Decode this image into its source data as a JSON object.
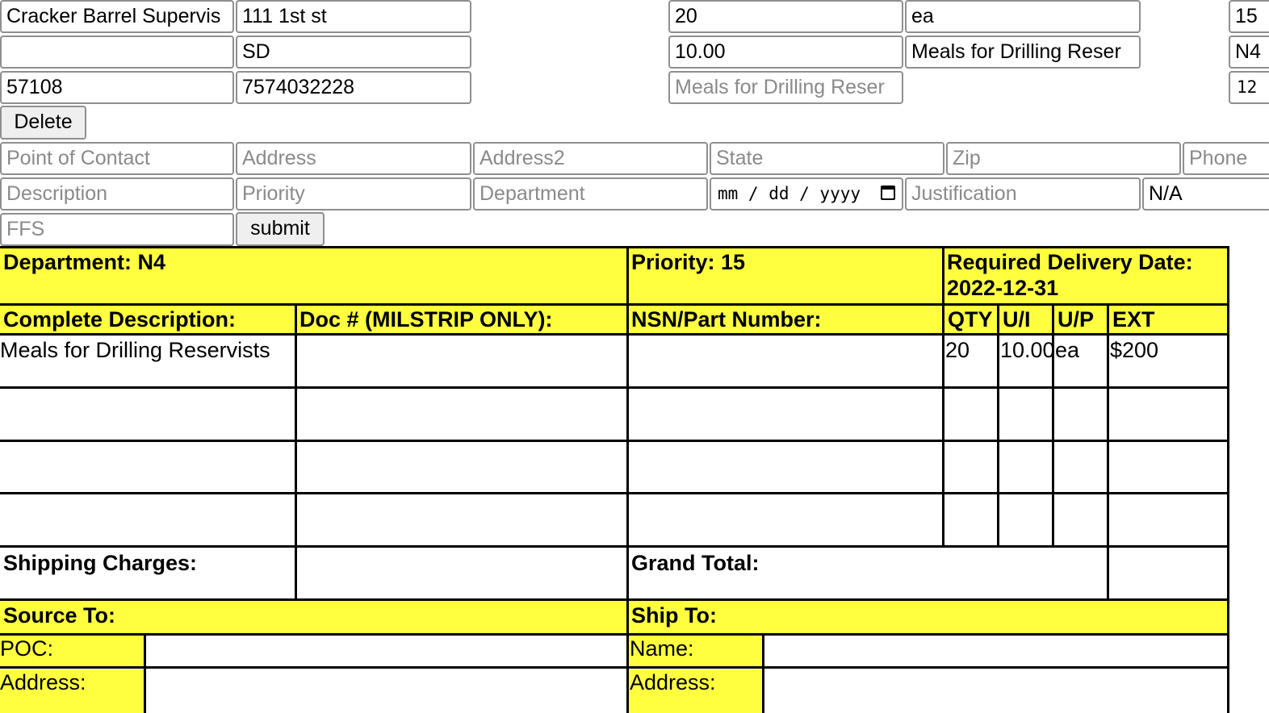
{
  "saved_entry": {
    "col1": [
      "Cracker Barrel Supervis",
      "",
      "57108"
    ],
    "col2": [
      "111 1st st",
      "SD",
      "7574032228"
    ],
    "col3": [
      "20",
      "10.00"
    ],
    "col3_placeholder": "Meals for Drilling Reser",
    "col4": [
      "ea",
      "Meals for Drilling Reser"
    ],
    "col5": [
      "15",
      "N4",
      "12"
    ],
    "delete_label": "Delete"
  },
  "new_entry": {
    "placeholders": {
      "point_of_contact": "Point of Contact",
      "address": "Address",
      "address2": "Address2",
      "state": "State",
      "zip": "Zip",
      "phone": "Phone",
      "description": "Description",
      "priority": "Priority",
      "department": "Department",
      "date": "mm / dd / yyyy",
      "justification": "Justification",
      "ffs": "FFS"
    },
    "na_value": "N/A",
    "submit_label": "submit"
  },
  "form": {
    "department_label": "Department: N4",
    "priority_label": "Priority: 15",
    "delivery_label": "Required Delivery Date: 2022-12-31",
    "headers": {
      "description": "Complete Description:",
      "doc": "Doc # (MILSTRIP ONLY):",
      "nsn": "NSN/Part Number:",
      "qty": "QTY",
      "ui": "U/I",
      "up": "U/P",
      "ext": "EXT"
    },
    "items": [
      {
        "description": "Meals for Drilling Reservists",
        "doc": "",
        "nsn": "",
        "qty": "20",
        "ui": "10.00",
        "up": "ea",
        "ext": "$200"
      }
    ],
    "shipping_label": "Shipping Charges:",
    "grand_total_label": "Grand Total:",
    "source_to_label": "Source To:",
    "ship_to_label": "Ship To:",
    "poc_label": "POC:",
    "address_label": "Address:",
    "name_label": "Name:",
    "ship_address_label": "Address:"
  }
}
